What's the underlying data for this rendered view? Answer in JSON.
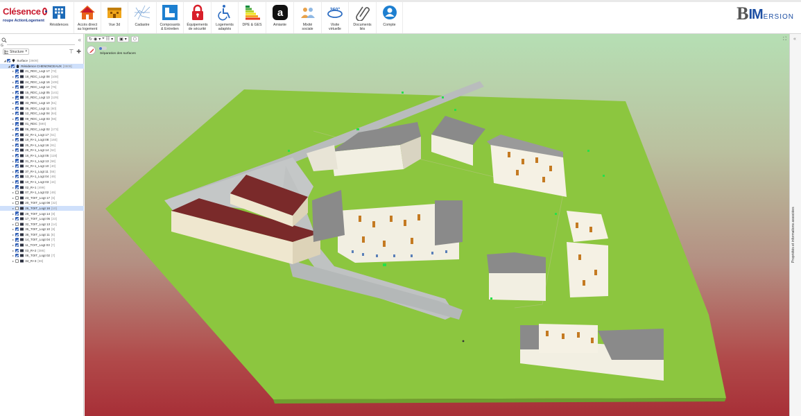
{
  "brand": {
    "name": "Clésence",
    "subtitle": "roupe ActionLogement"
  },
  "toolbar": [
    {
      "id": "residences",
      "label": "Résidences",
      "icon": "building-icon"
    },
    {
      "id": "acces",
      "label": "Accès direct\nau logement",
      "icon": "home-icon"
    },
    {
      "id": "vue3d",
      "label": "Vue 3d",
      "icon": "cube-3d-icon"
    },
    {
      "id": "cadastre",
      "label": "Cadastre",
      "icon": "cadastre-map-icon"
    },
    {
      "id": "composants",
      "label": "Composants\n& Entretien",
      "icon": "components-icon"
    },
    {
      "id": "securite",
      "label": "Équipements\nde sécurité",
      "icon": "padlock-icon"
    },
    {
      "id": "adaptes",
      "label": "Logements\nadaptés",
      "icon": "wheelchair-icon"
    },
    {
      "id": "dpe",
      "label": "DPE & GES",
      "icon": "energy-label-icon"
    },
    {
      "id": "amiante",
      "label": "Amiante",
      "icon": "asbestos-icon"
    },
    {
      "id": "mixite",
      "label": "Mixité\nsociale",
      "icon": "people-icon"
    },
    {
      "id": "visite",
      "label": "Visite\nvirtuelle",
      "icon": "360-view-icon"
    },
    {
      "id": "documents",
      "label": "Documents\nliés",
      "icon": "paperclip-icon"
    },
    {
      "id": "compte",
      "label": "Compte",
      "icon": "user-account-icon"
    }
  ],
  "logo": {
    "b": "B",
    "im": "IM",
    "rest": "ERSION"
  },
  "left_panel": {
    "search_placeholder": "",
    "g_label": "G",
    "structure_label": "Structure",
    "tree": [
      {
        "label": "Surface",
        "count": "[3609]",
        "level": 0,
        "checked": true,
        "icon": "pin",
        "selected": false
      },
      {
        "label": "Résidence CHENONCEAUX",
        "count": "[3608]",
        "level": 1,
        "checked": true,
        "icon": "home",
        "selected": true
      },
      {
        "label": "21_RDC_Logt 17",
        "count": "[72]",
        "level": 2,
        "checked": true,
        "selected": false
      },
      {
        "label": "18_RDC_Logt 08",
        "count": "[108]",
        "level": 2,
        "checked": true,
        "selected": false
      },
      {
        "label": "24_RDC_Logt 16",
        "count": "[108]",
        "level": 2,
        "checked": true,
        "selected": false
      },
      {
        "label": "27_RDC_Logt 14",
        "count": "[76]",
        "level": 2,
        "checked": true,
        "selected": false
      },
      {
        "label": "15_RDC_Logt 05",
        "count": "[141]",
        "level": 2,
        "checked": true,
        "selected": false
      },
      {
        "label": "30_RDC_Logt 13",
        "count": "[129]",
        "level": 2,
        "checked": true,
        "selected": false
      },
      {
        "label": "33_RDC_Logt 10",
        "count": "[51]",
        "level": 2,
        "checked": true,
        "selected": false
      },
      {
        "label": "36_RDC_Logt 11",
        "count": "[60]",
        "level": 2,
        "checked": true,
        "selected": false
      },
      {
        "label": "12_RDC_Logt 04",
        "count": "[64]",
        "level": 2,
        "checked": true,
        "selected": false
      },
      {
        "label": "09_RDC_Logt 03",
        "count": "[56]",
        "level": 2,
        "checked": true,
        "selected": false
      },
      {
        "label": "01_RDC",
        "count": "[590]",
        "level": 2,
        "checked": true,
        "selected": false
      },
      {
        "label": "06_RDC_Logt 02",
        "count": "[173]",
        "level": 2,
        "checked": true,
        "selected": false
      },
      {
        "label": "22_R+1_Logt 17",
        "count": "[51]",
        "level": 2,
        "checked": true,
        "selected": false
      },
      {
        "label": "19_R+1_Logt 08",
        "count": "[160]",
        "level": 2,
        "checked": true,
        "selected": false
      },
      {
        "label": "25_R+1_Logt 16",
        "count": "[91]",
        "level": 2,
        "checked": true,
        "selected": false
      },
      {
        "label": "28_R+1_Logt 14",
        "count": "[52]",
        "level": 2,
        "checked": true,
        "selected": false
      },
      {
        "label": "16_R+1_Logt 05",
        "count": "[118]",
        "level": 2,
        "checked": true,
        "selected": false
      },
      {
        "label": "31_R+1_Logt 13",
        "count": "[58]",
        "level": 2,
        "checked": true,
        "selected": false
      },
      {
        "label": "34_R+1_Logt 10",
        "count": "[40]",
        "level": 2,
        "checked": true,
        "selected": false
      },
      {
        "label": "37_R+1_Logt 11",
        "count": "[55]",
        "level": 2,
        "checked": true,
        "selected": false
      },
      {
        "label": "13_R+1_Logt 04",
        "count": "[49]",
        "level": 2,
        "checked": true,
        "selected": false
      },
      {
        "label": "10_R+1_Logt 03",
        "count": "[44]",
        "level": 2,
        "checked": true,
        "selected": false
      },
      {
        "label": "02_R+1",
        "count": "[499]",
        "level": 2,
        "checked": true,
        "selected": false
      },
      {
        "label": "07_R+1_Logt 02",
        "count": "[49]",
        "level": 2,
        "checked": false,
        "selected": false
      },
      {
        "label": "23_TOIT_Logt 17",
        "count": "[6]",
        "level": 2,
        "checked": false,
        "selected": false
      },
      {
        "label": "20_TOIT_Logt 08",
        "count": "[32]",
        "level": 2,
        "checked": false,
        "selected": false
      },
      {
        "label": "26_TOIT_Logt 16",
        "count": "[10]",
        "level": 2,
        "checked": false,
        "selected": true
      },
      {
        "label": "29_TOIT_Logt 14",
        "count": "[8]",
        "level": 2,
        "checked": true,
        "selected": false
      },
      {
        "label": "17_TOIT_Logt 05",
        "count": "[23]",
        "level": 2,
        "checked": true,
        "selected": false
      },
      {
        "label": "32_TOIT_Logt 13",
        "count": "[14]",
        "level": 2,
        "checked": false,
        "selected": false
      },
      {
        "label": "35_TOIT_Logt 10",
        "count": "[8]",
        "level": 2,
        "checked": true,
        "selected": false
      },
      {
        "label": "38_TOIT_Logt 11",
        "count": "[6]",
        "level": 2,
        "checked": true,
        "selected": false
      },
      {
        "label": "14_TOIT_Logt 04",
        "count": "[7]",
        "level": 2,
        "checked": true,
        "selected": false
      },
      {
        "label": "11_TOIT_Logt 03",
        "count": "[7]",
        "level": 2,
        "checked": true,
        "selected": false
      },
      {
        "label": "03_R+2",
        "count": "[386]",
        "level": 2,
        "checked": true,
        "selected": false
      },
      {
        "label": "08_TOIT_Logt 02",
        "count": "[7]",
        "level": 2,
        "checked": true,
        "selected": false
      },
      {
        "label": "34_R+3",
        "count": "[59]",
        "level": 2,
        "checked": false,
        "selected": false
      }
    ]
  },
  "viewer": {
    "separation_label": "Séparation des surfaces"
  },
  "right_panel": {
    "label": "Propriétés et informations associées"
  },
  "colors": {
    "brand_red": "#c9192d",
    "brand_blue": "#1f3b8c",
    "lawn": "#8cc63f",
    "roof_red": "#7a2a2a",
    "roof_gray": "#8a8a8a",
    "wall": "#f2efe2"
  }
}
